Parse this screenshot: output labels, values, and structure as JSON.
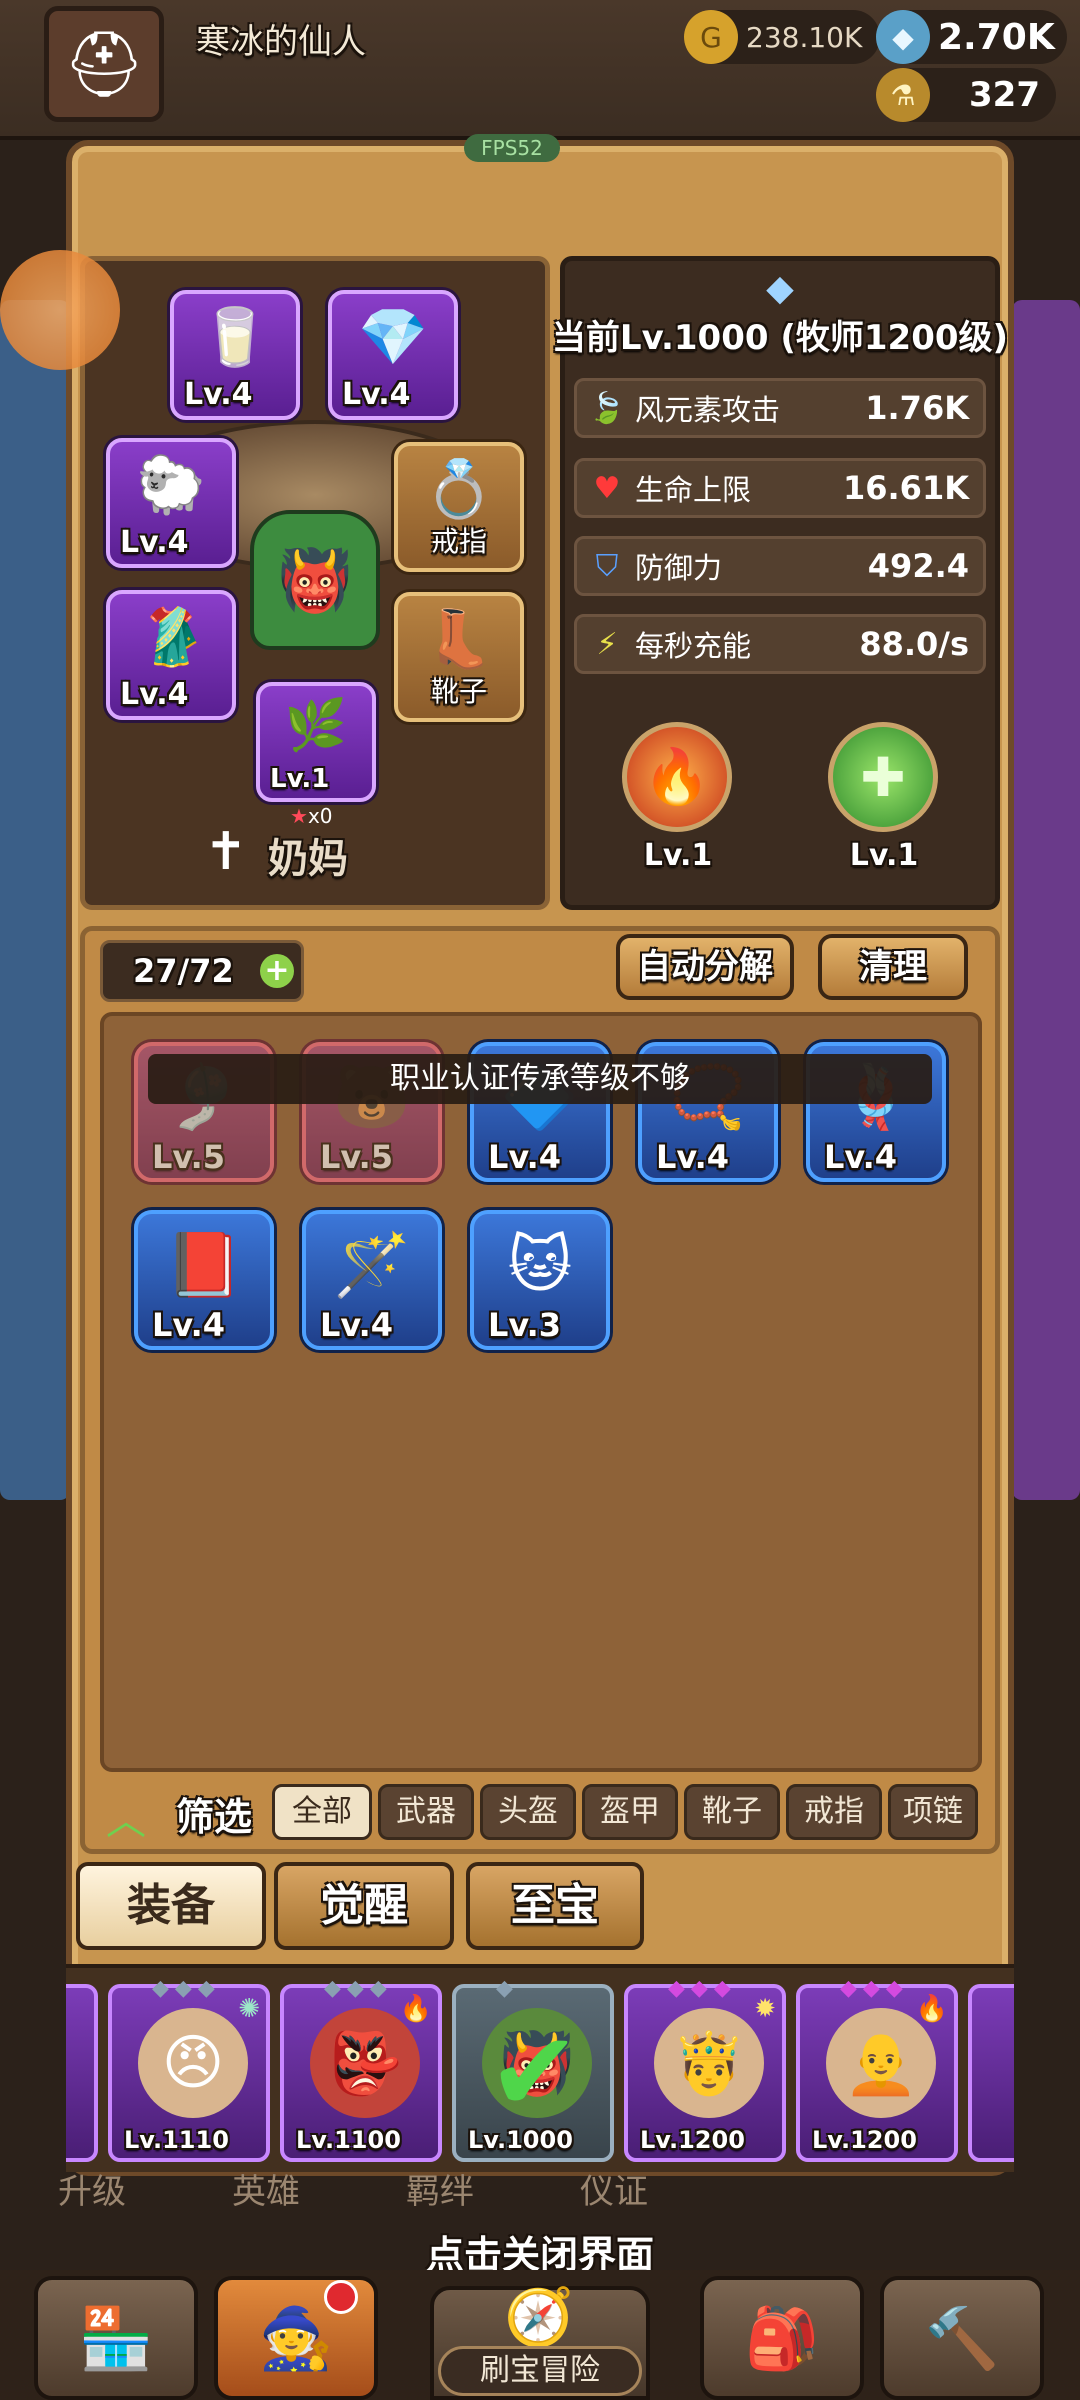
{
  "topbar": {
    "player_name": "寒冰的仙人",
    "gold": "238.10K",
    "gems": "2.70K",
    "potion": "327"
  },
  "fps": "FPS52",
  "hero": {
    "name": "奶妈",
    "star_count": "x0",
    "level_title": "当前Lv.1000 (牧师1200级)",
    "slots": {
      "horn": "Lv.4",
      "necklace": "Lv.4",
      "helmet": "Lv.4",
      "armor": "Lv.4",
      "weapon": "Lv.1",
      "ring_label": "戒指",
      "boots_label": "靴子"
    },
    "stats": [
      {
        "name": "风元素攻击",
        "value": "1.76K",
        "icon": "wind-icon"
      },
      {
        "name": "生命上限",
        "value": "16.61K",
        "icon": "heart-icon"
      },
      {
        "name": "防御力",
        "value": "492.4",
        "icon": "shield-icon"
      },
      {
        "name": "每秒充能",
        "value": "88.0/s",
        "icon": "energy-icon"
      }
    ],
    "skills": [
      {
        "level": "Lv.1",
        "icon": "fire-skill-icon"
      },
      {
        "level": "Lv.1",
        "icon": "heal-skill-icon"
      }
    ]
  },
  "inventory": {
    "capacity": "27/72",
    "auto_decompose": "自动分解",
    "clear": "清理",
    "tooltip": "职业认证传承等级不够",
    "items": [
      {
        "level": "Lv.5"
      },
      {
        "level": "Lv.5"
      },
      {
        "level": "Lv.4"
      },
      {
        "level": "Lv.4"
      },
      {
        "level": "Lv.4"
      },
      {
        "level": "Lv.4"
      },
      {
        "level": "Lv.4"
      },
      {
        "level": "Lv.3"
      }
    ]
  },
  "filter": {
    "label": "筛选",
    "chips": [
      "全部",
      "武器",
      "头盔",
      "盔甲",
      "靴子",
      "戒指",
      "项链"
    ]
  },
  "tabs": [
    "装备",
    "觉醒",
    "至宝"
  ],
  "roster": [
    {
      "level": "Lv.1110"
    },
    {
      "level": "Lv.1100"
    },
    {
      "level": "Lv.1000"
    },
    {
      "level": "Lv.1200"
    },
    {
      "level": "Lv.1200"
    }
  ],
  "bottom": {
    "close_hint": "点击关闭界面",
    "center_label": "刷宝冒险",
    "faint_labels": [
      "升级",
      "英雄",
      "羁绊",
      "仪证"
    ]
  },
  "colors": {
    "panel": "#c7954f",
    "epic_purple": "#8a3ec9",
    "rare_blue": "#3c77d9",
    "accent_green": "#8ed14a"
  }
}
